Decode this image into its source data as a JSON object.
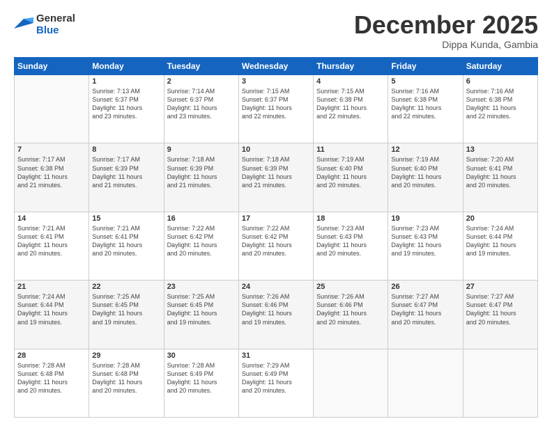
{
  "header": {
    "logo_line1": "General",
    "logo_line2": "Blue",
    "month": "December 2025",
    "location": "Dippa Kunda, Gambia"
  },
  "days_of_week": [
    "Sunday",
    "Monday",
    "Tuesday",
    "Wednesday",
    "Thursday",
    "Friday",
    "Saturday"
  ],
  "weeks": [
    [
      {
        "num": "",
        "info": ""
      },
      {
        "num": "1",
        "info": "Sunrise: 7:13 AM\nSunset: 6:37 PM\nDaylight: 11 hours\nand 23 minutes."
      },
      {
        "num": "2",
        "info": "Sunrise: 7:14 AM\nSunset: 6:37 PM\nDaylight: 11 hours\nand 23 minutes."
      },
      {
        "num": "3",
        "info": "Sunrise: 7:15 AM\nSunset: 6:37 PM\nDaylight: 11 hours\nand 22 minutes."
      },
      {
        "num": "4",
        "info": "Sunrise: 7:15 AM\nSunset: 6:38 PM\nDaylight: 11 hours\nand 22 minutes."
      },
      {
        "num": "5",
        "info": "Sunrise: 7:16 AM\nSunset: 6:38 PM\nDaylight: 11 hours\nand 22 minutes."
      },
      {
        "num": "6",
        "info": "Sunrise: 7:16 AM\nSunset: 6:38 PM\nDaylight: 11 hours\nand 22 minutes."
      }
    ],
    [
      {
        "num": "7",
        "info": "Sunrise: 7:17 AM\nSunset: 6:38 PM\nDaylight: 11 hours\nand 21 minutes."
      },
      {
        "num": "8",
        "info": "Sunrise: 7:17 AM\nSunset: 6:39 PM\nDaylight: 11 hours\nand 21 minutes."
      },
      {
        "num": "9",
        "info": "Sunrise: 7:18 AM\nSunset: 6:39 PM\nDaylight: 11 hours\nand 21 minutes."
      },
      {
        "num": "10",
        "info": "Sunrise: 7:18 AM\nSunset: 6:39 PM\nDaylight: 11 hours\nand 21 minutes."
      },
      {
        "num": "11",
        "info": "Sunrise: 7:19 AM\nSunset: 6:40 PM\nDaylight: 11 hours\nand 20 minutes."
      },
      {
        "num": "12",
        "info": "Sunrise: 7:19 AM\nSunset: 6:40 PM\nDaylight: 11 hours\nand 20 minutes."
      },
      {
        "num": "13",
        "info": "Sunrise: 7:20 AM\nSunset: 6:41 PM\nDaylight: 11 hours\nand 20 minutes."
      }
    ],
    [
      {
        "num": "14",
        "info": "Sunrise: 7:21 AM\nSunset: 6:41 PM\nDaylight: 11 hours\nand 20 minutes."
      },
      {
        "num": "15",
        "info": "Sunrise: 7:21 AM\nSunset: 6:41 PM\nDaylight: 11 hours\nand 20 minutes."
      },
      {
        "num": "16",
        "info": "Sunrise: 7:22 AM\nSunset: 6:42 PM\nDaylight: 11 hours\nand 20 minutes."
      },
      {
        "num": "17",
        "info": "Sunrise: 7:22 AM\nSunset: 6:42 PM\nDaylight: 11 hours\nand 20 minutes."
      },
      {
        "num": "18",
        "info": "Sunrise: 7:23 AM\nSunset: 6:43 PM\nDaylight: 11 hours\nand 20 minutes."
      },
      {
        "num": "19",
        "info": "Sunrise: 7:23 AM\nSunset: 6:43 PM\nDaylight: 11 hours\nand 19 minutes."
      },
      {
        "num": "20",
        "info": "Sunrise: 7:24 AM\nSunset: 6:44 PM\nDaylight: 11 hours\nand 19 minutes."
      }
    ],
    [
      {
        "num": "21",
        "info": "Sunrise: 7:24 AM\nSunset: 6:44 PM\nDaylight: 11 hours\nand 19 minutes."
      },
      {
        "num": "22",
        "info": "Sunrise: 7:25 AM\nSunset: 6:45 PM\nDaylight: 11 hours\nand 19 minutes."
      },
      {
        "num": "23",
        "info": "Sunrise: 7:25 AM\nSunset: 6:45 PM\nDaylight: 11 hours\nand 19 minutes."
      },
      {
        "num": "24",
        "info": "Sunrise: 7:26 AM\nSunset: 6:46 PM\nDaylight: 11 hours\nand 19 minutes."
      },
      {
        "num": "25",
        "info": "Sunrise: 7:26 AM\nSunset: 6:46 PM\nDaylight: 11 hours\nand 20 minutes."
      },
      {
        "num": "26",
        "info": "Sunrise: 7:27 AM\nSunset: 6:47 PM\nDaylight: 11 hours\nand 20 minutes."
      },
      {
        "num": "27",
        "info": "Sunrise: 7:27 AM\nSunset: 6:47 PM\nDaylight: 11 hours\nand 20 minutes."
      }
    ],
    [
      {
        "num": "28",
        "info": "Sunrise: 7:28 AM\nSunset: 6:48 PM\nDaylight: 11 hours\nand 20 minutes."
      },
      {
        "num": "29",
        "info": "Sunrise: 7:28 AM\nSunset: 6:48 PM\nDaylight: 11 hours\nand 20 minutes."
      },
      {
        "num": "30",
        "info": "Sunrise: 7:28 AM\nSunset: 6:49 PM\nDaylight: 11 hours\nand 20 minutes."
      },
      {
        "num": "31",
        "info": "Sunrise: 7:29 AM\nSunset: 6:49 PM\nDaylight: 11 hours\nand 20 minutes."
      },
      {
        "num": "",
        "info": ""
      },
      {
        "num": "",
        "info": ""
      },
      {
        "num": "",
        "info": ""
      }
    ]
  ]
}
